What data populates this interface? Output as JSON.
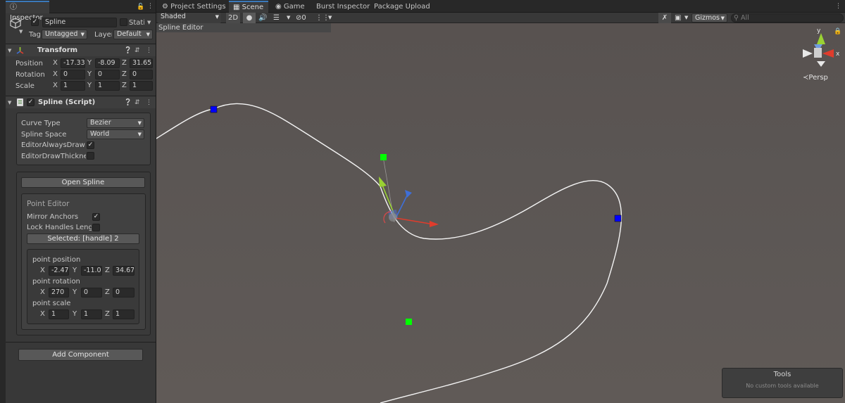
{
  "inspector": {
    "tab_label": "Inspector",
    "lock_icon": "lock-icon",
    "object": {
      "name": "Spline",
      "static_label": "Static",
      "tag_label": "Tag",
      "tag_value": "Untagged",
      "layer_label": "Layer",
      "layer_value": "Default"
    },
    "transform": {
      "title": "Transform",
      "position_label": "Position",
      "position": {
        "x": "-17.33",
        "y": "-8.09",
        "z": "31.65"
      },
      "rotation_label": "Rotation",
      "rotation": {
        "x": "0",
        "y": "0",
        "z": "0"
      },
      "scale_label": "Scale",
      "scale": {
        "x": "1",
        "y": "1",
        "z": "1"
      }
    },
    "spline_script": {
      "title": "Spline (Script)",
      "curve_type_label": "Curve Type",
      "curve_type_value": "Bezier",
      "spline_space_label": "Spline Space",
      "spline_space_value": "World",
      "editor_always_draw_label": "EditorAlwaysDraw",
      "editor_always_draw": true,
      "editor_draw_thickness_label": "EditorDrawThicknes",
      "editor_draw_thickness": false,
      "open_spline_button": "Open Spline",
      "point_editor": {
        "title": "Point Editor",
        "mirror_anchors_label": "Mirror Anchors",
        "mirror_anchors": true,
        "lock_handles_label": "Lock Handles Lengtl",
        "lock_handles": false,
        "selected_button": "Selected: [handle] 2",
        "point_position_label": "point position",
        "point_position": {
          "x": "-2.47:",
          "y": "-11.0:",
          "z": "34.67"
        },
        "point_rotation_label": "point rotation",
        "point_rotation": {
          "x": "270",
          "y": "0",
          "z": "0"
        },
        "point_scale_label": "point scale",
        "point_scale": {
          "x": "1",
          "y": "1",
          "z": "1"
        }
      }
    },
    "add_component_button": "Add Component",
    "axis_labels": {
      "x": "X",
      "y": "Y",
      "z": "Z"
    }
  },
  "scene_tabs": [
    "Project Settings",
    "Scene",
    "Game",
    "Burst Inspector",
    "Package Upload"
  ],
  "scene_toolbar": {
    "draw_mode": "Shaded",
    "mode_2d": "2D",
    "hidden_count": "0",
    "gizmos": "Gizmos",
    "search_placeholder": "All"
  },
  "spline_editor_label": "Spline Editor",
  "orientation_gizmo": {
    "y_label": "y",
    "x_label": "x",
    "projection": "Persp"
  },
  "tools_panel": {
    "title": "Tools",
    "message": "No custom tools available"
  },
  "colors": {
    "accent": "#3a79bb",
    "anchor": "#0000ff",
    "handle": "#00ff00",
    "x_axis": "#e03c2c",
    "y_axis": "#9ad233",
    "z_axis": "#3f6fd8"
  }
}
